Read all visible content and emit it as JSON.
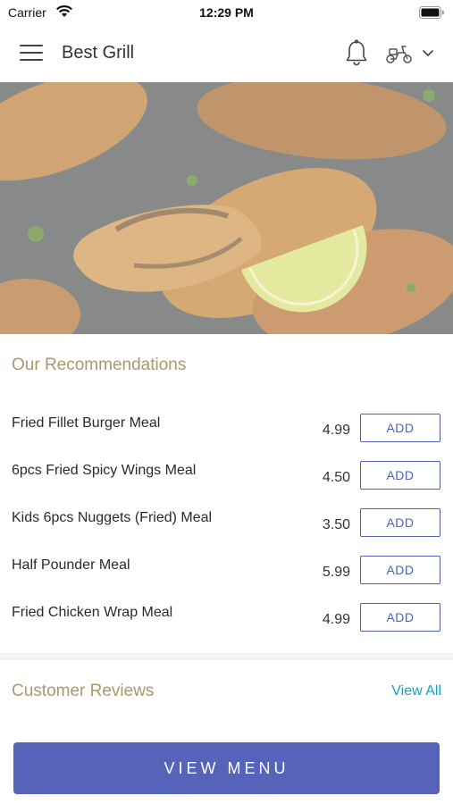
{
  "status_bar": {
    "carrier": "Carrier",
    "time": "12:29 PM"
  },
  "header": {
    "title": "Best Grill",
    "icons": [
      "menu-icon",
      "bell-icon",
      "scooter-icon",
      "chevron-down-icon"
    ]
  },
  "hero": {
    "image": "grilled-chicken-photo"
  },
  "recommendations": {
    "title": "Our Recommendations",
    "items": [
      {
        "name": "Fried Fillet Burger Meal",
        "price": "4.99",
        "button": "ADD"
      },
      {
        "name": "6pcs Fried Spicy Wings Meal",
        "price": "4.50",
        "button": "ADD"
      },
      {
        "name": "Kids 6pcs Nuggets (Fried) Meal",
        "price": "3.50",
        "button": "ADD"
      },
      {
        "name": "Half Pounder Meal",
        "price": "5.99",
        "button": "ADD"
      },
      {
        "name": "Fried Chicken Wrap Meal",
        "price": "4.99",
        "button": "ADD"
      }
    ]
  },
  "reviews": {
    "title": "Customer Reviews",
    "view_all": "View All"
  },
  "cta": {
    "label": "VIEW MENU"
  },
  "colors": {
    "accent": "#5564b8",
    "section_title": "#a89a6e",
    "link": "#1aa0c9"
  }
}
